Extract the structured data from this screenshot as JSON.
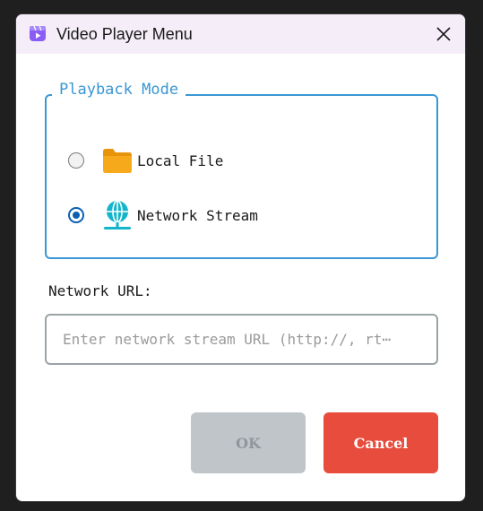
{
  "window": {
    "title": "Video Player Menu",
    "app_icon": "video-player-icon",
    "close_icon": "close-icon"
  },
  "playback_mode": {
    "legend": "Playback Mode",
    "options": [
      {
        "label": "Local File",
        "icon": "folder-icon",
        "selected": false
      },
      {
        "label": "Network Stream",
        "icon": "globe-network-icon",
        "selected": true
      }
    ]
  },
  "network_url": {
    "label": "Network URL:",
    "value": "",
    "placeholder": "Enter network stream URL (http://, rt⋯"
  },
  "buttons": {
    "ok_label": "OK",
    "cancel_label": "Cancel"
  },
  "colors": {
    "accent": "#3a97d4",
    "radio_selected": "#0a5fb4",
    "ok_disabled_bg": "#bfc5c9",
    "cancel_bg": "#e74c3c",
    "titlebar_bg": "#f5eef8"
  }
}
